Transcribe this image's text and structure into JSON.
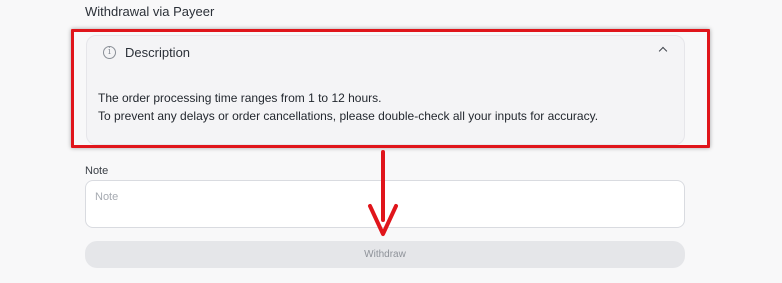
{
  "section_title": "Withdrawal via Payeer",
  "description": {
    "icon": "info-icon",
    "info_glyph": "i",
    "title": "Description",
    "expanded": true,
    "lines": [
      "The order processing time ranges from 1 to 12 hours.",
      "To prevent any delays or order cancellations, please double-check all your inputs for accuracy."
    ]
  },
  "note": {
    "label": "Note",
    "placeholder": "Note",
    "value": ""
  },
  "withdraw_button": {
    "label": "Withdraw",
    "enabled": false
  },
  "annotation_colors": {
    "highlight": "#e0151b",
    "arrow": "#e0151b"
  }
}
